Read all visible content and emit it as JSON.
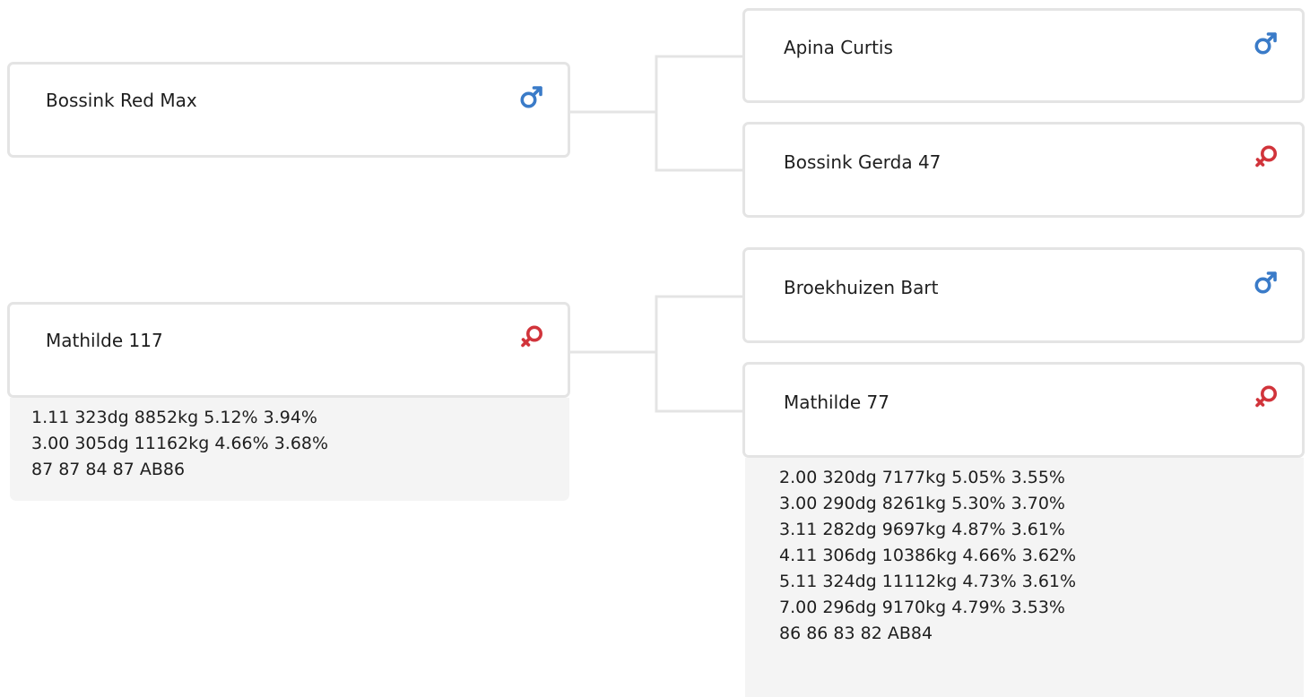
{
  "colors": {
    "male": "#3a7bc8",
    "female": "#d1343b",
    "card_border": "#e4e4e4",
    "connector": "#e4e4e4",
    "perf_background": "#f4f4f4"
  },
  "pedigree": {
    "sire": {
      "name": "Bossink Red Max",
      "sex_icon": "male-icon",
      "sire": {
        "name": "Apina Curtis",
        "sex_icon": "male-icon"
      },
      "dam": {
        "name": "Bossink Gerda 47",
        "sex_icon": "female-icon"
      }
    },
    "dam": {
      "name": "Mathilde 117",
      "sex_icon": "female-icon",
      "performance": [
        "1.11 323dg 8852kg 5.12% 3.94%",
        "3.00 305dg 11162kg 4.66% 3.68%",
        "87 87 84 87 AB86"
      ],
      "sire": {
        "name": "Broekhuizen Bart",
        "sex_icon": "male-icon"
      },
      "dam": {
        "name": "Mathilde 77",
        "sex_icon": "female-icon",
        "performance": [
          "2.00 320dg 7177kg 5.05% 3.55%",
          "3.00 290dg 8261kg 5.30% 3.70%",
          "3.11 282dg 9697kg 4.87% 3.61%",
          "4.11 306dg 10386kg 4.66% 3.62%",
          "5.11 324dg 11112kg 4.73% 3.61%",
          "7.00 296dg 9170kg 4.79% 3.53%",
          "86 86 83 82 AB84"
        ]
      }
    }
  }
}
